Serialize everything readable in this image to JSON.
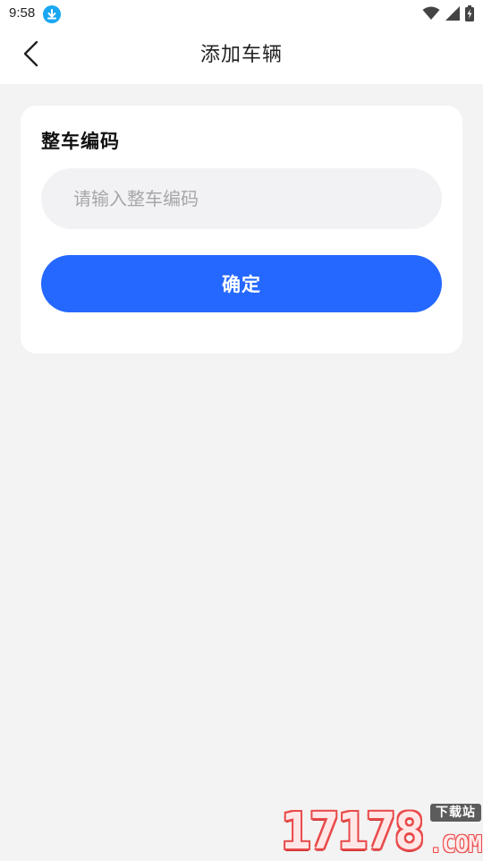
{
  "status_bar": {
    "time": "9:58",
    "icons": [
      "download-icon",
      "wifi-icon",
      "signal-icon",
      "battery-charging-icon"
    ],
    "download_color": "#1aa7f2"
  },
  "header": {
    "title": "添加车辆",
    "back_icon": "chevron-left-icon"
  },
  "form": {
    "label": "整车编码",
    "input_value": "",
    "input_placeholder": "请输入整车编码",
    "confirm_label": "确定"
  },
  "colors": {
    "accent": "#2568ff",
    "background": "#f3f3f3",
    "input_background": "#f2f2f4"
  },
  "watermark": {
    "digits": "17178",
    "badge": "下载站",
    "domain": ".COM"
  }
}
